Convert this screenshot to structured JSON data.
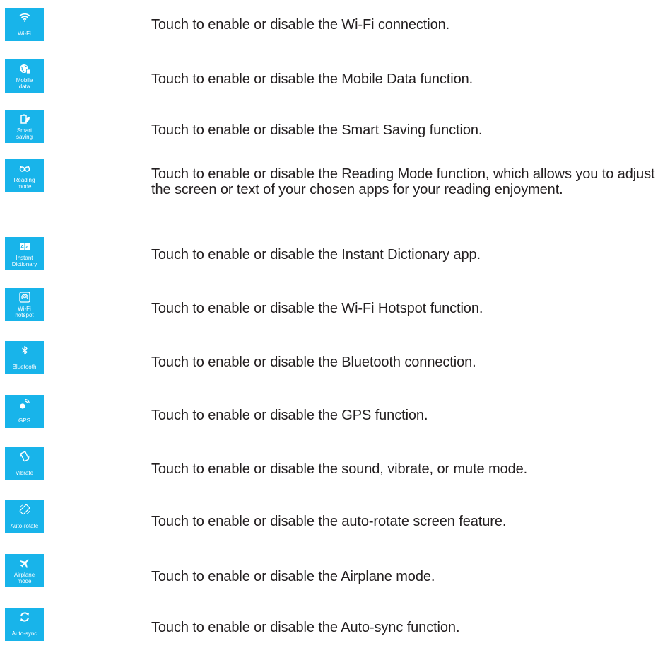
{
  "accent_color": "#18b4ea",
  "items": [
    {
      "label": "Wi-Fi",
      "icon": "wifi-icon",
      "description": "Touch to enable or disable the Wi-Fi connection."
    },
    {
      "label": "Mobile\ndata",
      "icon": "globe-icon",
      "description": "Touch to enable or disable the Mobile Data function."
    },
    {
      "label": "Smart\nsaving",
      "icon": "battery-leaf-icon",
      "description": "Touch to enable or disable the Smart Saving function."
    },
    {
      "label": "Reading\nmode",
      "icon": "glasses-icon",
      "description": "Touch to enable or disable the Reading Mode function, which allows you to adjust the screen or text of your chosen apps for your reading enjoyment."
    },
    {
      "label": "Instant\nDictionary",
      "icon": "dictionary-icon",
      "description": "Touch to enable or disable the Instant Dictionary app."
    },
    {
      "label": "Wi-Fi\nhotspot",
      "icon": "hotspot-icon",
      "description": "Touch to enable or disable the Wi-Fi Hotspot function."
    },
    {
      "label": "Bluetooth",
      "icon": "bluetooth-icon",
      "description": "Touch to enable or disable the Bluetooth connection."
    },
    {
      "label": "GPS",
      "icon": "gps-icon",
      "description": "Touch to enable or disable the GPS function."
    },
    {
      "label": "Vibrate",
      "icon": "vibrate-icon",
      "description": "Touch to enable or disable the sound, vibrate, or mute mode."
    },
    {
      "label": "Auto-rotate",
      "icon": "rotate-icon",
      "description": "Touch to enable or disable the auto-rotate screen feature."
    },
    {
      "label": "Airplane\nmode",
      "icon": "airplane-icon",
      "description": "Touch to enable or disable the Airplane mode."
    },
    {
      "label": "Auto-sync",
      "icon": "sync-icon",
      "description": "Touch to enable or disable the Auto-sync function."
    }
  ]
}
